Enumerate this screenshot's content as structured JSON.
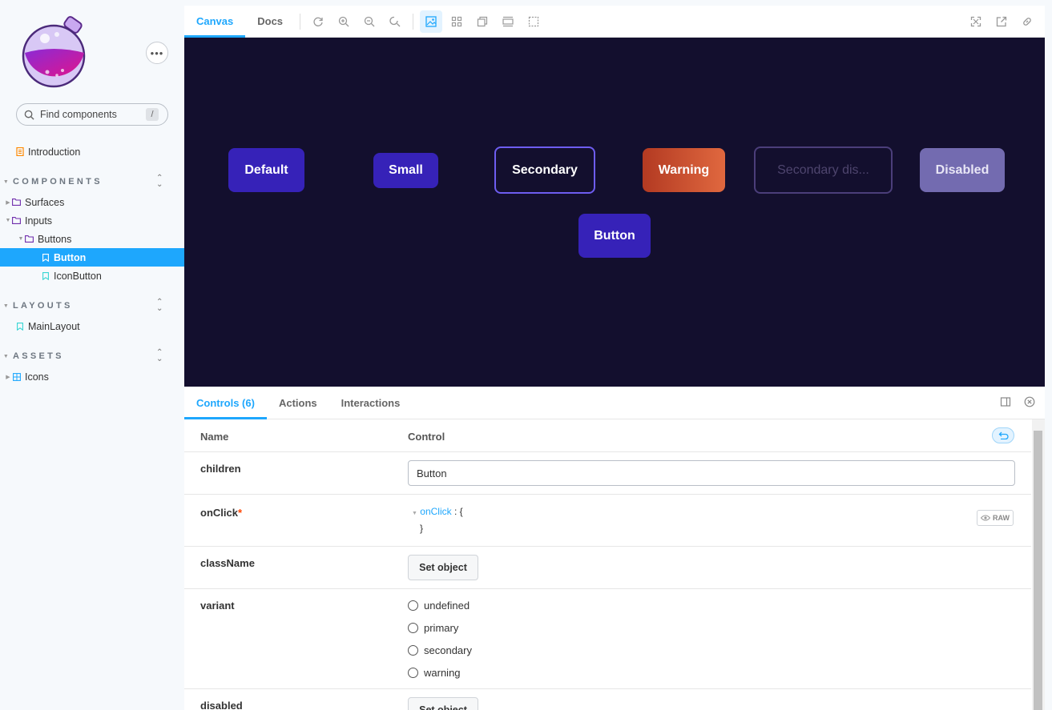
{
  "sidebar": {
    "more_label": "•••",
    "search": {
      "placeholder": "Find components",
      "shortcut": "/"
    },
    "introduction": "Introduction",
    "sections": {
      "components": "COMPONENTS",
      "layouts": "LAYOUTS",
      "assets": "ASSETS"
    },
    "items": {
      "surfaces": "Surfaces",
      "inputs": "Inputs",
      "buttons": "Buttons",
      "button": "Button",
      "iconbutton": "IconButton",
      "mainlayout": "MainLayout",
      "icons": "Icons"
    }
  },
  "toolbar": {
    "tabs": [
      "Canvas",
      "Docs"
    ],
    "active_tab": "Canvas"
  },
  "canvas": {
    "buttons": [
      "Default",
      "Small",
      "Secondary",
      "Warning",
      "Secondary dis...",
      "Disabled",
      "Button"
    ]
  },
  "panel": {
    "tabs": [
      "Controls (6)",
      "Actions",
      "Interactions"
    ],
    "active_tab": "Controls (6)",
    "headers": {
      "name": "Name",
      "control": "Control"
    },
    "rows": {
      "children": {
        "name": "children",
        "value": "Button"
      },
      "onclick": {
        "name": "onClick",
        "required_mark": "*",
        "key": "onClick",
        "colon": " : {",
        "close": "}",
        "raw_label": "RAW"
      },
      "classname": {
        "name": "className",
        "button": "Set object"
      },
      "variant": {
        "name": "variant",
        "options": [
          "undefined",
          "primary",
          "secondary",
          "warning"
        ]
      },
      "disabled": {
        "name": "disabled",
        "button": "Set object"
      }
    }
  },
  "colors": {
    "accent": "#1ea7fd",
    "canvas_bg": "#130f2e",
    "primary_button": "#3622b8"
  }
}
